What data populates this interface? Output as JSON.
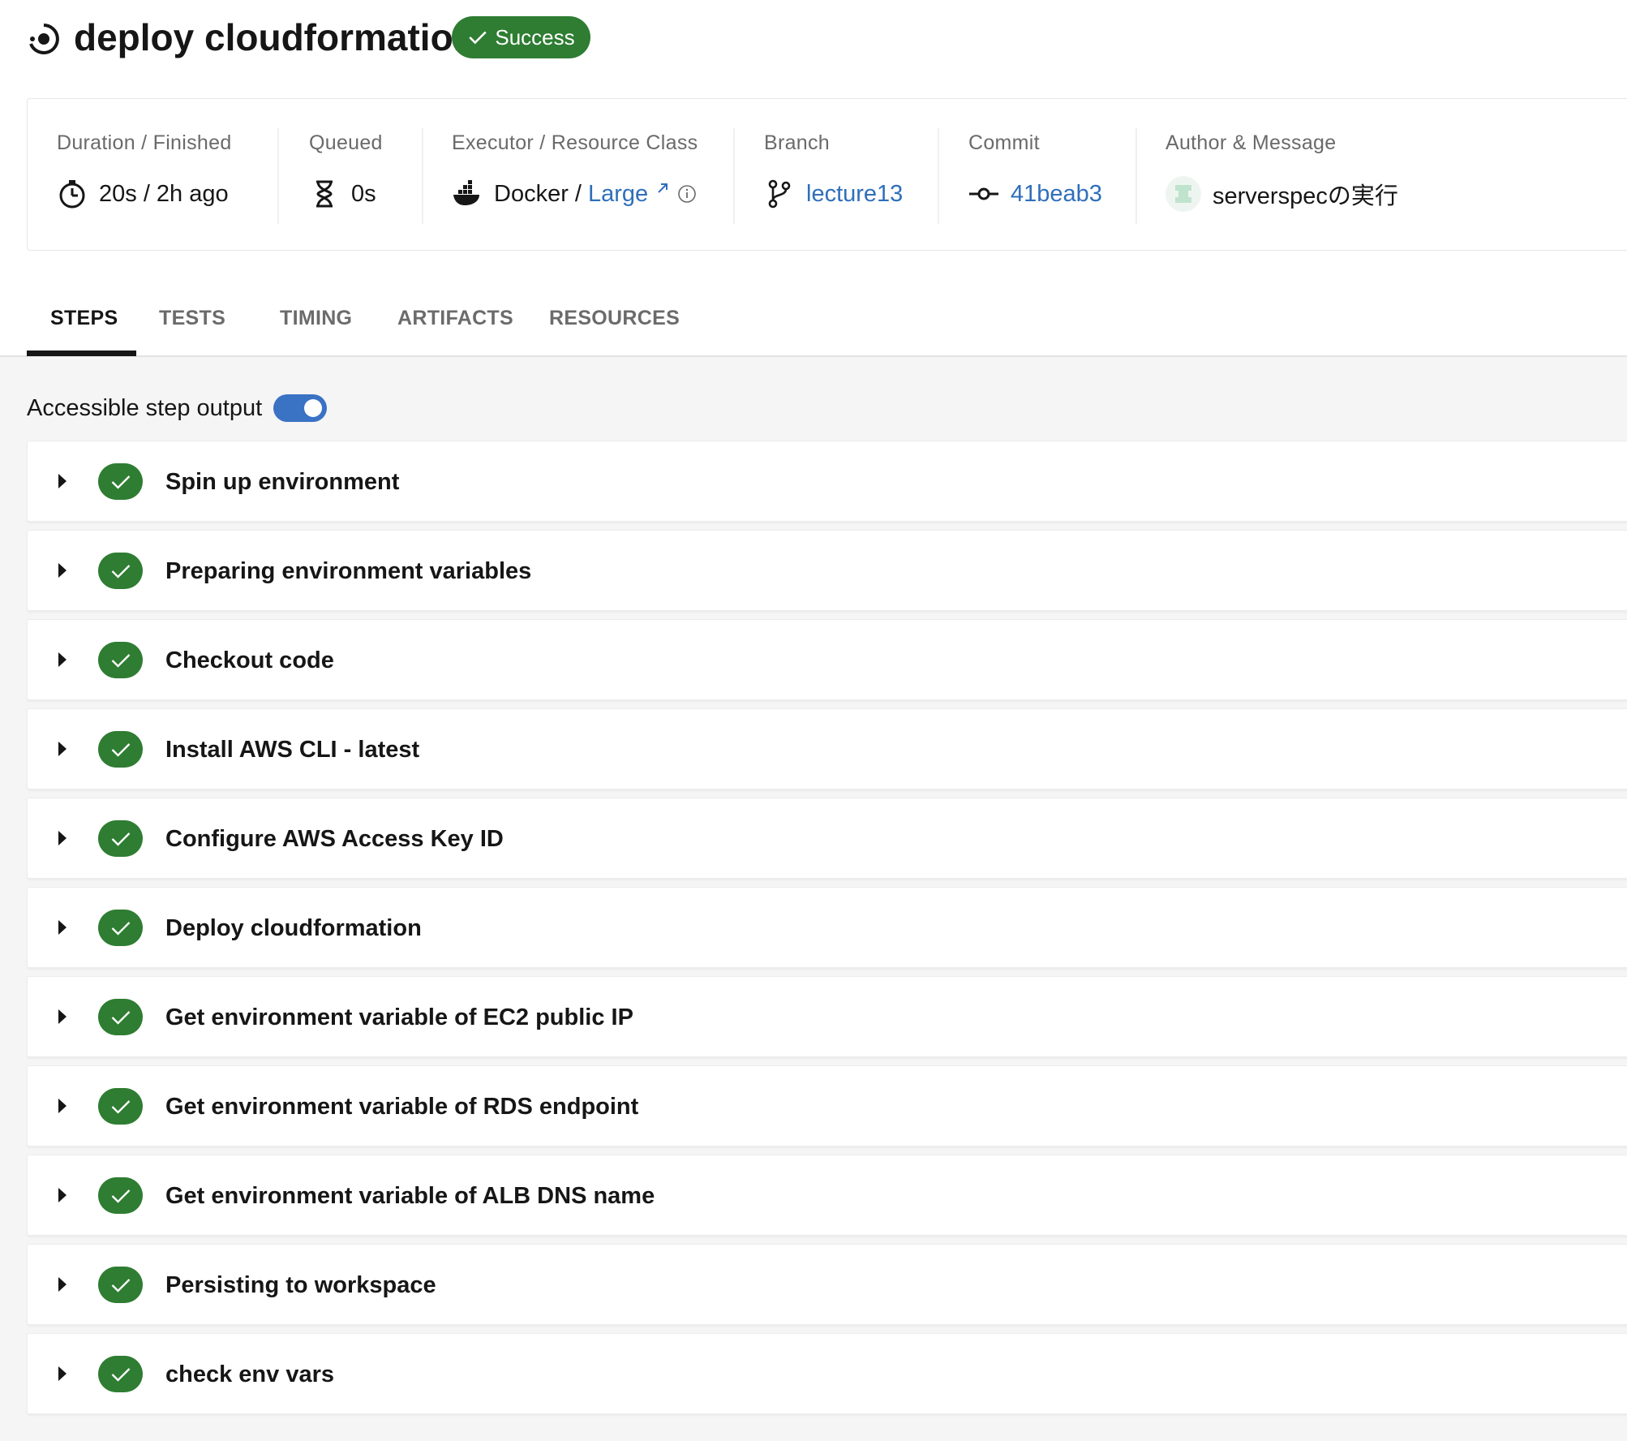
{
  "header": {
    "title": "deploy cloudformation",
    "status": "Success",
    "status_color": "#2e7d32"
  },
  "meta": {
    "duration": {
      "label": "Duration / Finished",
      "value": "20s / 2h ago",
      "icon": "stopwatch-icon"
    },
    "queued": {
      "label": "Queued",
      "value": "0s",
      "icon": "hourglass-icon"
    },
    "executor": {
      "label": "Executor / Resource Class",
      "executor": "Docker /",
      "resource_class": "Large",
      "icon": "docker-icon"
    },
    "branch": {
      "label": "Branch",
      "value": "lecture13",
      "icon": "branch-icon"
    },
    "commit": {
      "label": "Commit",
      "value": "41beab3",
      "icon": "commit-icon"
    },
    "author": {
      "label": "Author & Message",
      "message": "serverspecの実行",
      "icon": "avatar-identicon"
    }
  },
  "tabs": [
    {
      "label": "STEPS",
      "active": true
    },
    {
      "label": "TESTS",
      "active": false
    },
    {
      "label": "TIMING",
      "active": false
    },
    {
      "label": "ARTIFACTS",
      "active": false
    },
    {
      "label": "RESOURCES",
      "active": false
    }
  ],
  "toggle": {
    "label": "Accessible step output",
    "on": true,
    "color": "#3a72c4"
  },
  "steps": [
    {
      "name": "Spin up environment",
      "status": "success"
    },
    {
      "name": "Preparing environment variables",
      "status": "success"
    },
    {
      "name": "Checkout code",
      "status": "success"
    },
    {
      "name": "Install AWS CLI - latest",
      "status": "success"
    },
    {
      "name": "Configure AWS Access Key ID",
      "status": "success"
    },
    {
      "name": "Deploy cloudformation",
      "status": "success"
    },
    {
      "name": "Get environment variable of EC2 public IP",
      "status": "success"
    },
    {
      "name": "Get environment variable of RDS endpoint",
      "status": "success"
    },
    {
      "name": "Get environment variable of ALB DNS name",
      "status": "success"
    },
    {
      "name": "Persisting to workspace",
      "status": "success"
    },
    {
      "name": "check env vars",
      "status": "success"
    }
  ],
  "colors": {
    "link": "#2f6fba",
    "success": "#2e7d32"
  }
}
